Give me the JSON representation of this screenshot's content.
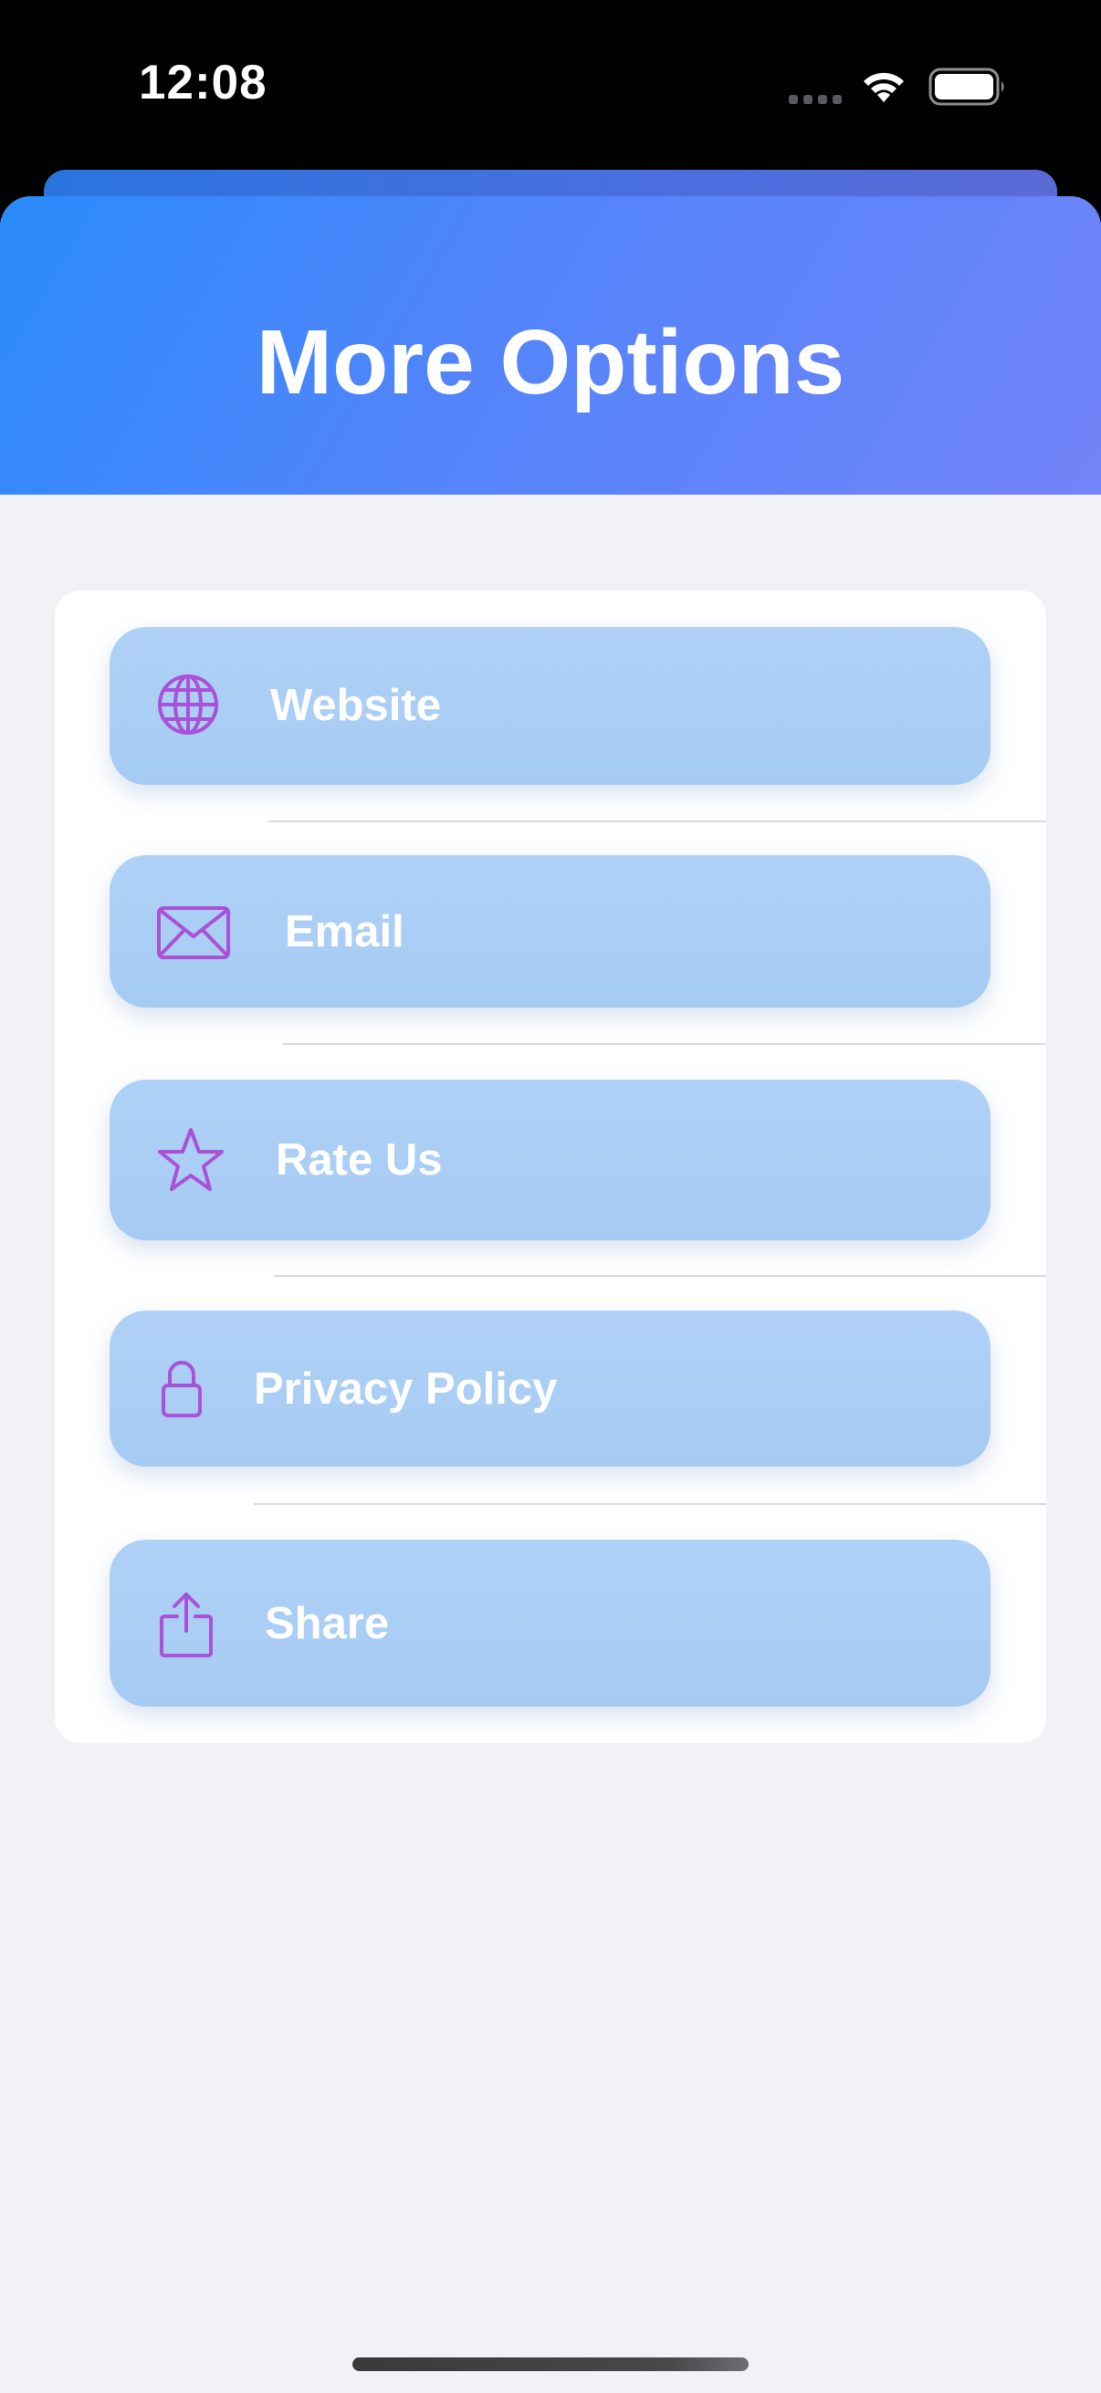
{
  "status_bar": {
    "time": "12:08"
  },
  "header": {
    "title": "More Options",
    "gradient_start": "#2a8bfb",
    "gradient_end": "#7284f8"
  },
  "options": [
    {
      "label": "Website",
      "icon": "globe-icon"
    },
    {
      "label": "Email",
      "icon": "envelope-icon"
    },
    {
      "label": "Rate Us",
      "icon": "star-icon"
    },
    {
      "label": "Privacy Policy",
      "icon": "lock-icon"
    },
    {
      "label": "Share",
      "icon": "share-icon"
    }
  ],
  "colors": {
    "button_fill": "#a9cdf5",
    "icon_tint": "#a951d8",
    "background": "#f1f1f6",
    "card": "#ffffff"
  }
}
